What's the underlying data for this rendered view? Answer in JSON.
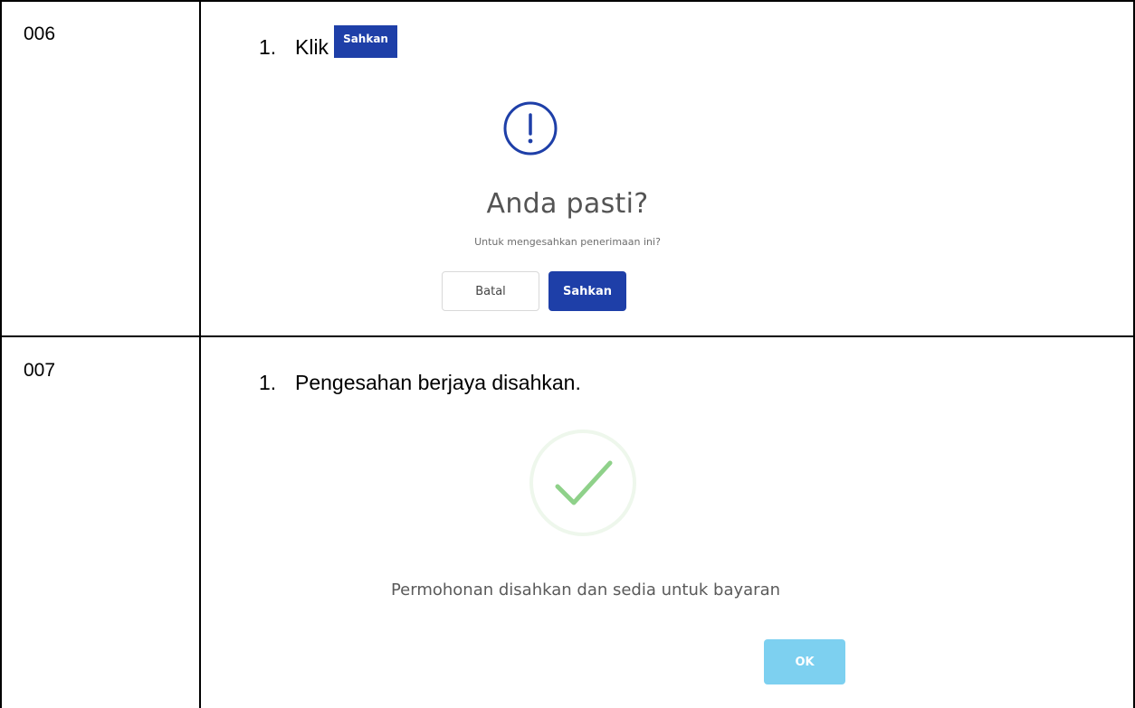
{
  "rows": [
    {
      "id": "006",
      "step_number": "1.",
      "step_text": "Klik",
      "inline_button_label": "Sahkan",
      "dialog": {
        "icon": "exclamation-circle-icon",
        "title": "Anda pasti?",
        "subtitle": "Untuk mengesahkan penerimaan ini?",
        "cancel_label": "Batal",
        "confirm_label": "Sahkan"
      }
    },
    {
      "id": "007",
      "step_number": "1.",
      "step_text": "Pengesahan berjaya disahkan.",
      "dialog": {
        "icon": "checkmark-circle-icon",
        "message": "Permohonan disahkan dan sedia untuk bayaran",
        "ok_label": "OK"
      }
    }
  ],
  "colors": {
    "primary": "#1e3fa8",
    "ok_button": "#7dd0f0",
    "success": "#8fd18a",
    "border": "#000000"
  }
}
